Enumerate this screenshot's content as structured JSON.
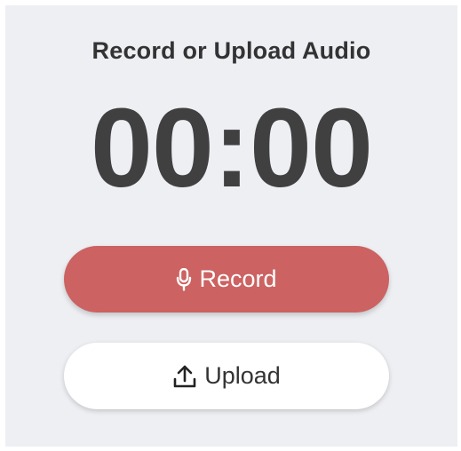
{
  "panel": {
    "title": "Record or Upload Audio",
    "timer": "00:00"
  },
  "buttons": {
    "record_label": "Record",
    "record_icon": "microphone-icon",
    "upload_label": "Upload",
    "upload_icon": "upload-icon"
  },
  "colors": {
    "record_button": "#cc6261",
    "panel_background": "#edeff3",
    "timer_text": "#404040"
  }
}
